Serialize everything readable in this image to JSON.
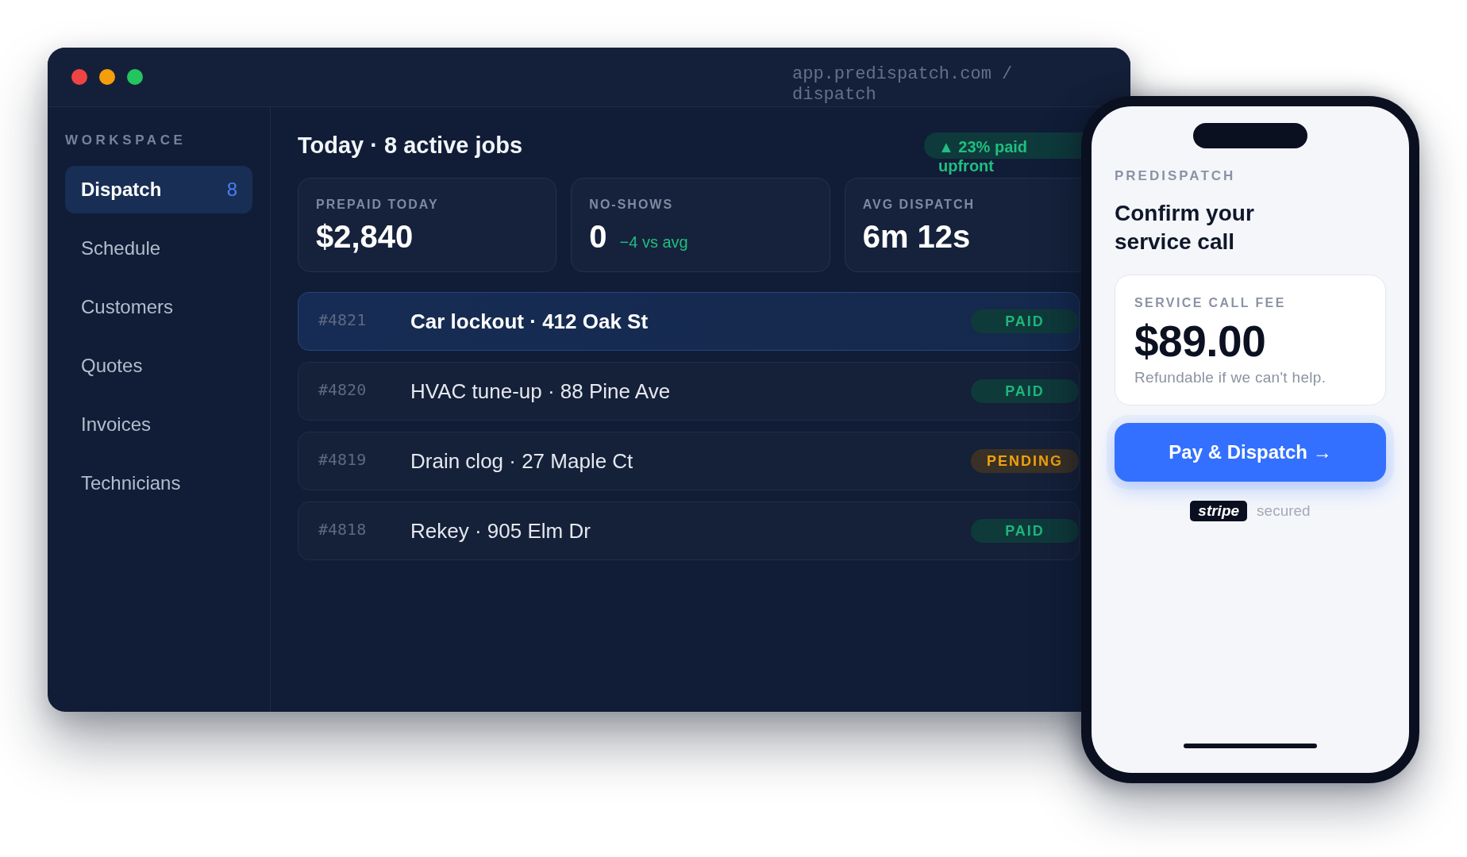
{
  "window": {
    "url": "app.predispatch.com / dispatch"
  },
  "sidebar": {
    "heading": "WORKSPACE",
    "items": [
      {
        "label": "Dispatch",
        "count": "8",
        "selected": true
      },
      {
        "label": "Schedule",
        "selected": false
      },
      {
        "label": "Customers",
        "selected": false
      },
      {
        "label": "Quotes",
        "selected": false
      },
      {
        "label": "Invoices",
        "selected": false
      },
      {
        "label": "Technicians",
        "selected": false
      }
    ]
  },
  "header": {
    "title": "Today · 8 active jobs",
    "badge": "▲ 23% paid upfront"
  },
  "stats": [
    {
      "label": "PREPAID TODAY",
      "value": "$2,840"
    },
    {
      "label": "NO-SHOWS",
      "value": "0",
      "delta": "−4 vs avg"
    },
    {
      "label": "AVG DISPATCH",
      "value": "6m 12s"
    }
  ],
  "jobs": [
    {
      "id": "#4821",
      "title": "Car lockout · 412 Oak St",
      "selected": true,
      "status": {
        "label": "PAID",
        "kind": "paid"
      }
    },
    {
      "id": "#4820",
      "title": "HVAC tune-up · 88 Pine Ave",
      "selected": false,
      "status": {
        "label": "PAID",
        "kind": "paid"
      }
    },
    {
      "id": "#4819",
      "title": "Drain clog · 27 Maple Ct",
      "selected": false,
      "status": {
        "label": "PENDING",
        "kind": "pending"
      }
    },
    {
      "id": "#4818",
      "title": "Rekey · 905 Elm Dr",
      "selected": false,
      "status": {
        "label": "PAID",
        "kind": "paid"
      }
    }
  ],
  "phone": {
    "brand": "PREDISPATCH",
    "heading": "Confirm your service call",
    "fee_card": {
      "label": "SERVICE CALL FEE",
      "amount": "$89.00",
      "note": "Refundable if we can't help."
    },
    "pay_button": "Pay & Dispatch →",
    "payment": {
      "provider": "stripe",
      "note": "secured"
    }
  }
}
